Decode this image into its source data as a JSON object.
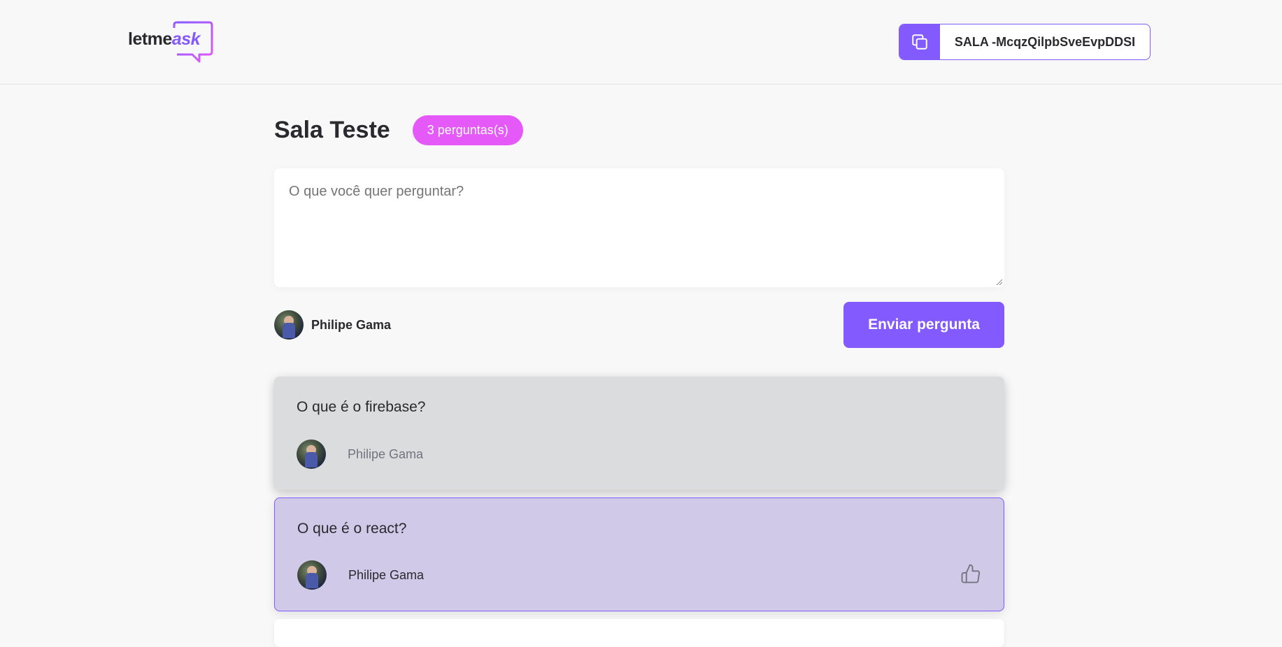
{
  "header": {
    "logo": {
      "text_main": "letme",
      "text_accent": "ask"
    },
    "room_code": {
      "label": "SALA -McqzQilpbSveEvpDDSI",
      "icon": "copy-icon"
    }
  },
  "room": {
    "title": "Sala Teste",
    "question_count_badge": "3 perguntas(s)"
  },
  "form": {
    "placeholder": "O que você quer perguntar?",
    "user_name": "Philipe Gama",
    "submit_label": "Enviar pergunta"
  },
  "questions": [
    {
      "text": "O que é o firebase?",
      "author": "Philipe Gama",
      "state": "answered"
    },
    {
      "text": "O que é o react?",
      "author": "Philipe Gama",
      "state": "highlighted",
      "icon": "thumbs-up-icon"
    },
    {
      "text": "",
      "author": "",
      "state": "normal"
    }
  ],
  "colors": {
    "accent": "#835afd",
    "badge": "#e559f9",
    "answered_bg": "#dbdcdd",
    "highlighted_bg": "#d1c9e8",
    "page_bg": "#f8f8f8"
  }
}
